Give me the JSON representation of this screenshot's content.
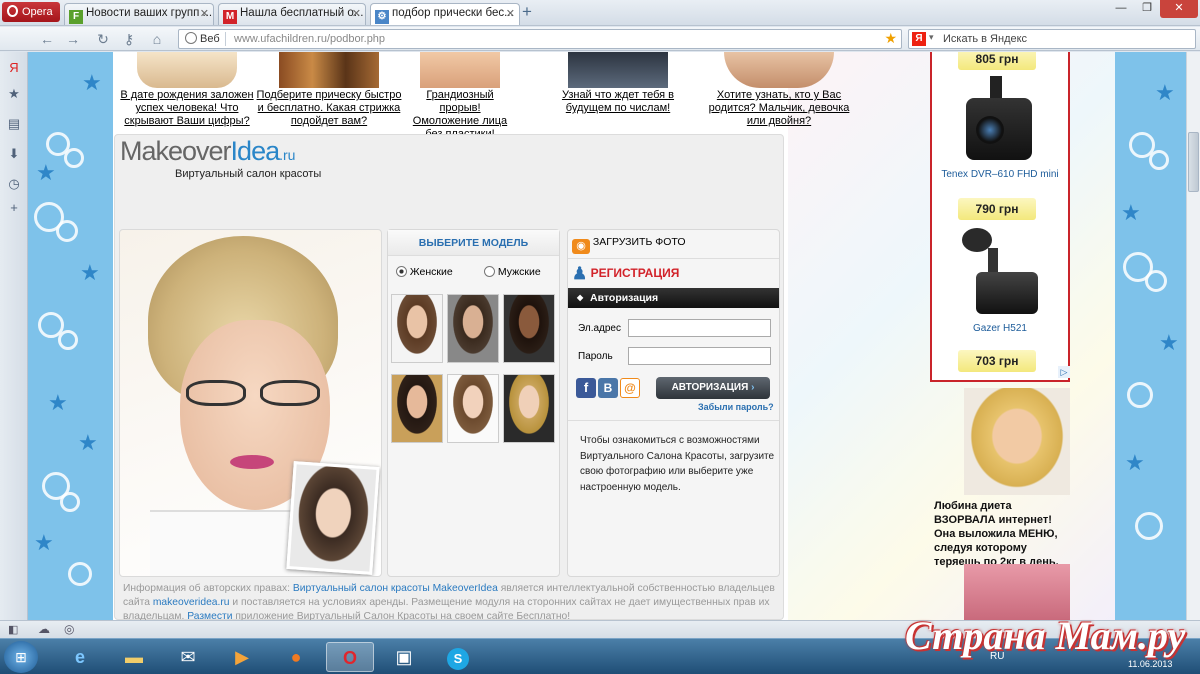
{
  "browser": {
    "menu_label": "Opera",
    "tabs": [
      {
        "title": "Новости ваших групп ...",
        "favicon": "F",
        "favcolor": "#5aa02c",
        "active": false
      },
      {
        "title": "Нашла бесплатный о...",
        "favicon": "M",
        "favcolor": "#d2232a",
        "active": false
      },
      {
        "title": "подбор прически бес...",
        "favicon": "⚙",
        "favcolor": "#4a86c8",
        "active": true
      }
    ],
    "new_tab": "+",
    "address": {
      "web_label": "Веб",
      "url_host": "www.ufachildren.ru",
      "url_path": "/podbor.php"
    },
    "search": {
      "engine": "Я",
      "placeholder": "Искать в Яндекс"
    }
  },
  "teasers": [
    {
      "text": "В дате рождения заложен успех человека! Что скрывают Ваши цифры?"
    },
    {
      "text": "Подберите прическу быстро и бесплатно. Какая стрижка подойдет вам?"
    },
    {
      "text": "Грандиозный прорыв! Омоложение лица без пластики!"
    },
    {
      "text": "Узнай что ждет тебя в будущем по числам!"
    },
    {
      "text": "Хотите узнать, кто у Вас родится? Мальчик, девочка или двойня?"
    }
  ],
  "widget": {
    "logo_main": "Makeover",
    "logo_accent": "Idea",
    "logo_tld": ".ru",
    "subtitle": "Виртуальный салон красоты",
    "choose_model": "ВЫБЕРИТЕ МОДЕЛЬ",
    "female": "Женские",
    "male": "Мужские",
    "upload_photo": "ЗАГРУЗИТЬ ФОТО",
    "registration": "РЕГИСТРАЦИЯ",
    "auth_header": "Авторизация",
    "email_label": "Эл.адрес",
    "password_label": "Пароль",
    "login_button": "АВТОРИЗАЦИЯ",
    "forgot": "Забыли пароль?",
    "social": [
      "f",
      "В",
      "@"
    ],
    "info": "Чтобы ознакомиться с возможностями Виртуального Салона Красоты, загрузите свою фотографию или выберите уже настроенную модель.",
    "copyright_lead": "Информация об авторских правах:",
    "copyright_link": "Виртуальный салон красоты MakeoverIdea",
    "copyright_mid": "является интеллектуальной собственностью владельцев сайта",
    "copyright_site": "makeoveridea.ru",
    "copyright_tail": "и поставляется на условиях аренды. Размещение модуля на сторонних сайтах не дает имущественных прав их владельцам.",
    "copyright_place": "Размести",
    "copyright_end": "приложение Виртуальный Салон Красоты на своем сайте Бесплатно!"
  },
  "ads": {
    "price_top": "805 грн",
    "item1_name": "Tenex DVR–610 FHD mini",
    "item1_price": "790 грн",
    "item2_name": "Gazer H521",
    "item2_price": "703 грн",
    "diet_text": "Любина диета ВЗОРВАЛА интернет! Она выложила МЕНЮ, следуя которому теряешь по 2кг в день."
  },
  "taskbar": {
    "lang": "RU",
    "date": "11.06.2013"
  },
  "watermark": "Страна Мам.ру"
}
